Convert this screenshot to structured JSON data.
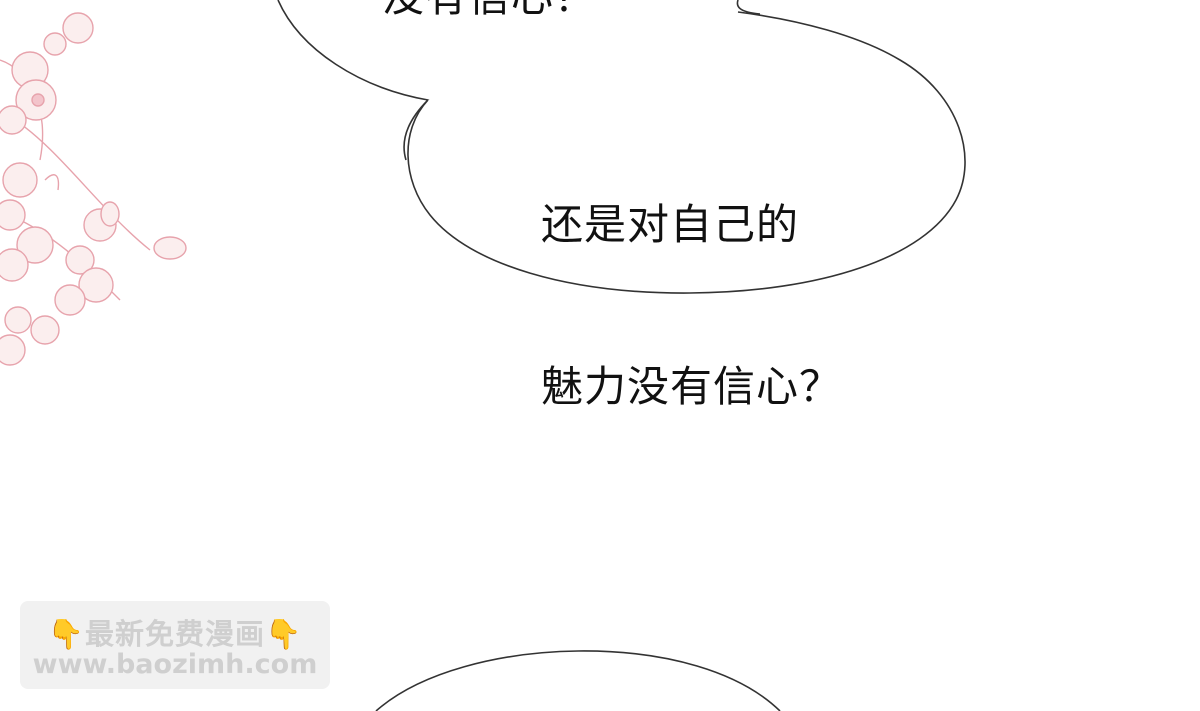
{
  "bubbles": {
    "top_partial_text": "没有信心？",
    "main_text_line1": "还是对自己的",
    "main_text_line2": "魅力没有信心？"
  },
  "watermark": {
    "hand_icon": "👇",
    "title": "最新免费漫画",
    "url": "www.baozimh.com"
  },
  "colors": {
    "bubble_stroke": "#333333",
    "flower_stroke": "#e7a3ac",
    "flower_fill": "#fbeeee",
    "watermark_bg": "#f1f1f1",
    "watermark_text": "#cfcfcf"
  }
}
